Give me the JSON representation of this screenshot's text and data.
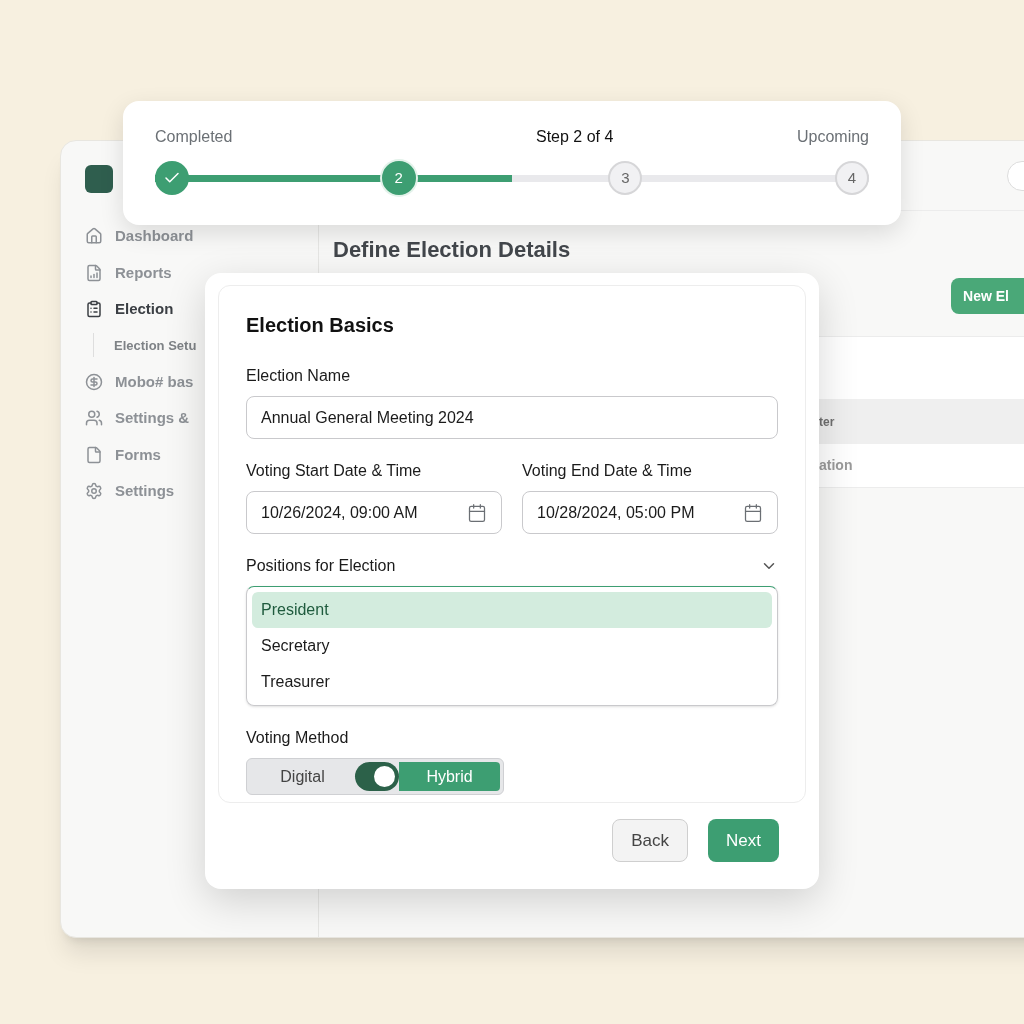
{
  "background_app": {
    "sidebar": {
      "items": [
        {
          "label": "Dashboard",
          "kind": "home",
          "selected": false
        },
        {
          "label": "Reports",
          "kind": "report",
          "selected": false
        },
        {
          "label": "Election",
          "kind": "clipboard",
          "selected": true,
          "children": [
            {
              "label": "Election Setu",
              "selected": false
            }
          ]
        },
        {
          "label": "Mobo# bas",
          "kind": "coin",
          "selected": false
        },
        {
          "label": "Settings &",
          "kind": "users",
          "selected": false
        },
        {
          "label": "Forms",
          "kind": "file",
          "selected": false
        },
        {
          "label": "Settings",
          "kind": "gear",
          "selected": false
        }
      ]
    },
    "page_title": "Define Election Details",
    "new_button": "New El",
    "table": {
      "column_1": "ter",
      "rows": [
        {
          "column_1": "ation"
        }
      ]
    }
  },
  "stepper": {
    "left_label": "Completed",
    "center_label": "Step 2 of 4",
    "right_label": "Upcoming",
    "level": 0.5,
    "steps": [
      {
        "kind": "done"
      },
      {
        "label": "2",
        "kind": "current"
      },
      {
        "label": "3",
        "kind": "upcoming"
      },
      {
        "label": "4",
        "kind": "upcoming"
      }
    ]
  },
  "dialog": {
    "title": "Election Basics",
    "election_name": {
      "label": "Election Name",
      "value": "Annual General Meeting 2024"
    },
    "start": {
      "label": "Voting Start Date & Time",
      "value": "10/26/2024, 09:00 AM"
    },
    "end": {
      "label": "Voting End Date & Time",
      "value": "10/28/2024, 05:00 PM"
    },
    "positions": {
      "label": "Positions for Election",
      "expanded": true,
      "options": [
        {
          "label": "President",
          "selected": true
        },
        {
          "label": "Secretary",
          "selected": false
        },
        {
          "label": "Treasurer",
          "selected": false
        }
      ]
    },
    "voting_method": {
      "label": "Voting Method",
      "switch_on": true,
      "options": [
        {
          "label": "Digital",
          "selected": false
        },
        {
          "label": "Hybrid",
          "selected": true
        }
      ]
    },
    "buttons": [
      {
        "label": "Back",
        "kind": "secondary"
      },
      {
        "label": "Next",
        "kind": "primary"
      }
    ]
  }
}
